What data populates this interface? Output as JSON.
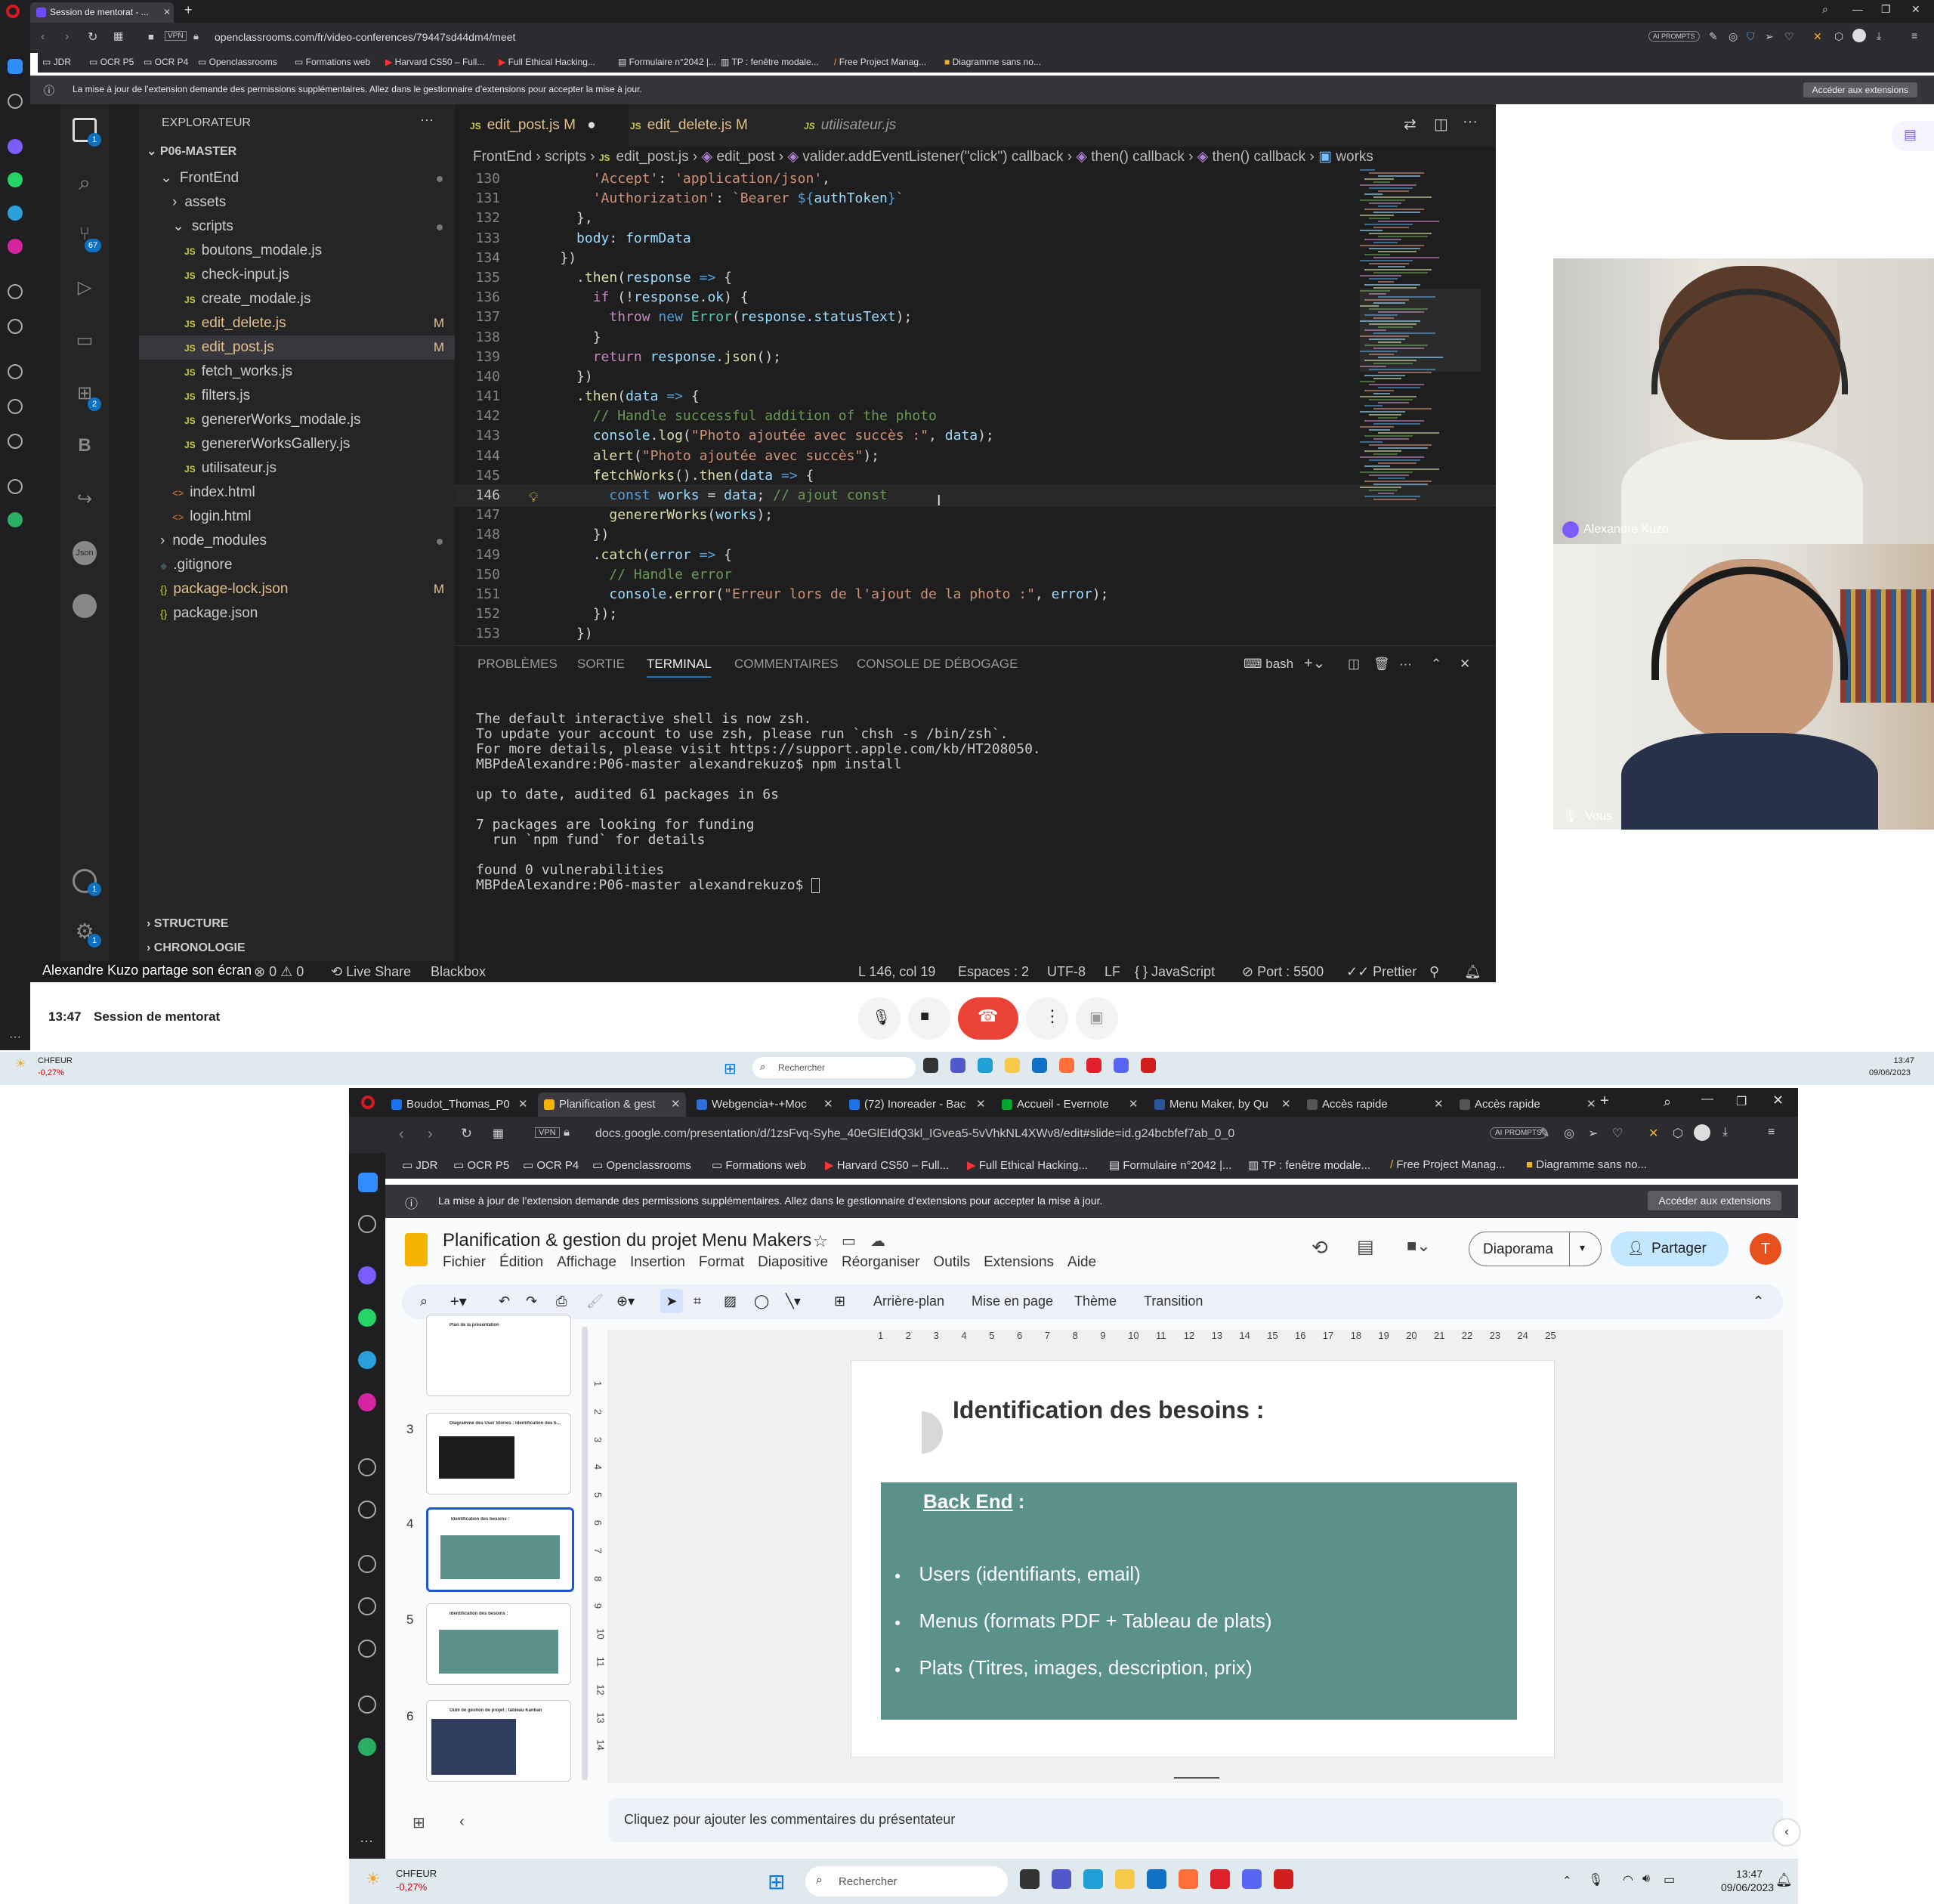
{
  "browser_top": {
    "tab_title": "Session de mentorat - ...",
    "url": "openclassrooms.com/fr/video-conferences/79447sd44dm4/meet",
    "vpn": "VPN",
    "ai_prompts": "AI PROMPTS",
    "bookmarks": [
      "JDR",
      "OCR P5",
      "OCR P4",
      "Openclassrooms",
      "Formations web",
      "Harvard CS50 – Full...",
      "Full Ethical Hacking...",
      "Formulaire n°2042 |...",
      "TP : fenêtre modale...",
      "Free Project Manag...",
      "Diagramme sans no..."
    ],
    "notice": "La mise à jour de l’extension demande des permissions supplémentaires. Allez dans le gestionnaire d’extensions pour accepter la mise à jour.",
    "notice_button": "Accéder aux extensions"
  },
  "vscode": {
    "explorer_title": "EXPLORATEUR",
    "root": "P06-MASTER",
    "tree": [
      {
        "name": "FrontEnd",
        "kind": "folder-open",
        "depth": 1,
        "dot": true
      },
      {
        "name": "assets",
        "kind": "folder",
        "depth": 2
      },
      {
        "name": "scripts",
        "kind": "folder-open",
        "depth": 2,
        "dot": true
      },
      {
        "name": "boutons_modale.js",
        "kind": "js",
        "depth": 3
      },
      {
        "name": "check-input.js",
        "kind": "js",
        "depth": 3
      },
      {
        "name": "create_modale.js",
        "kind": "js",
        "depth": 3
      },
      {
        "name": "edit_delete.js",
        "kind": "js",
        "depth": 3,
        "badge": "M"
      },
      {
        "name": "edit_post.js",
        "kind": "js",
        "depth": 3,
        "badge": "M",
        "selected": true
      },
      {
        "name": "fetch_works.js",
        "kind": "js",
        "depth": 3
      },
      {
        "name": "filters.js",
        "kind": "js",
        "depth": 3
      },
      {
        "name": "genererWorks_modale.js",
        "kind": "js",
        "depth": 3
      },
      {
        "name": "genererWorksGallery.js",
        "kind": "js",
        "depth": 3
      },
      {
        "name": "utilisateur.js",
        "kind": "js",
        "depth": 3
      },
      {
        "name": "index.html",
        "kind": "html",
        "depth": 2
      },
      {
        "name": "login.html",
        "kind": "html",
        "depth": 2
      },
      {
        "name": "node_modules",
        "kind": "folder",
        "depth": 1,
        "dot": true
      },
      {
        "name": ".gitignore",
        "kind": "git",
        "depth": 1
      },
      {
        "name": "package-lock.json",
        "kind": "json",
        "depth": 1,
        "badge": "M"
      },
      {
        "name": "package.json",
        "kind": "json",
        "depth": 1
      }
    ],
    "structure": "STRUCTURE",
    "chronologie": "CHRONOLOGIE",
    "tabs": [
      {
        "label": "edit_post.js",
        "mod": "M",
        "active": true
      },
      {
        "label": "edit_delete.js",
        "mod": "M"
      },
      {
        "label": "utilisateur.js",
        "italic": true
      }
    ],
    "breadcrumb": [
      "FrontEnd",
      "scripts",
      "edit_post.js",
      "edit_post",
      "valider.addEventListener(\"click\") callback",
      "then() callback",
      "then() callback",
      "works"
    ],
    "code_lines": [
      {
        "n": "130",
        "html": "        <span class=\"s\">'Accept'</span><span class=\"p\">: </span><span class=\"s\">'application/json'</span><span class=\"p\">,</span>"
      },
      {
        "n": "131",
        "html": "        <span class=\"s\">'Authorization'</span><span class=\"p\">: </span><span class=\"s\">`Bearer </span><span class=\"k\">${</span><span class=\"v\">authToken</span><span class=\"k\">}</span><span class=\"s\">`</span>"
      },
      {
        "n": "132",
        "html": "      <span class=\"p\">},</span>"
      },
      {
        "n": "133",
        "html": "      <span class=\"v\">body</span><span class=\"p\">: </span><span class=\"v\">formData</span>"
      },
      {
        "n": "134",
        "html": "    <span class=\"p\">})</span>"
      },
      {
        "n": "135",
        "html": "      <span class=\"p\">.</span><span class=\"f\">then</span><span class=\"p\">(</span><span class=\"v\">response</span> <span class=\"k\">=&gt;</span> <span class=\"p\">{</span>"
      },
      {
        "n": "136",
        "html": "        <span class=\"ctl\">if</span> <span class=\"p\">(!</span><span class=\"v\">response</span><span class=\"p\">.</span><span class=\"v\">ok</span><span class=\"p\">) {</span>"
      },
      {
        "n": "137",
        "html": "          <span class=\"ctl\">throw</span> <span class=\"k\">new</span> <span class=\"cls\">Error</span><span class=\"p\">(</span><span class=\"v\">response</span><span class=\"p\">.</span><span class=\"v\">statusText</span><span class=\"p\">);</span>"
      },
      {
        "n": "138",
        "html": "        <span class=\"p\">}</span>"
      },
      {
        "n": "139",
        "html": "        <span class=\"ctl\">return</span> <span class=\"v\">response</span><span class=\"p\">.</span><span class=\"f\">json</span><span class=\"p\">();</span>"
      },
      {
        "n": "140",
        "html": "      <span class=\"p\">})</span>"
      },
      {
        "n": "141",
        "html": "      <span class=\"p\">.</span><span class=\"f\">then</span><span class=\"p\">(</span><span class=\"v\">data</span> <span class=\"k\">=&gt;</span> <span class=\"p\">{</span>"
      },
      {
        "n": "142",
        "html": "        <span class=\"c\">// Handle successful addition of the photo</span>"
      },
      {
        "n": "143",
        "html": "        <span class=\"v\">console</span><span class=\"p\">.</span><span class=\"f\">log</span><span class=\"p\">(</span><span class=\"s\">\"Photo ajoutée avec succès :\"</span><span class=\"p\">, </span><span class=\"v\">data</span><span class=\"p\">);</span>"
      },
      {
        "n": "144",
        "html": "        <span class=\"f\">alert</span><span class=\"p\">(</span><span class=\"s\">\"Photo ajoutée avec succès\"</span><span class=\"p\">);</span>"
      },
      {
        "n": "145",
        "html": "        <span class=\"f\">fetchWorks</span><span class=\"p\">().</span><span class=\"f\">then</span><span class=\"p\">(</span><span class=\"v\">data</span> <span class=\"k\">=&gt;</span> <span class=\"p\">{</span>"
      },
      {
        "n": "146",
        "cur": true,
        "html": "          <span class=\"k\">const</span> <span class=\"v\">works</span> <span class=\"p\">= </span><span class=\"v\">data</span><span class=\"p\">; </span><span class=\"c\">// ajout const</span>"
      },
      {
        "n": "147",
        "html": "          <span class=\"f\">genererWorks</span><span class=\"p\">(</span><span class=\"v\">works</span><span class=\"p\">);</span>"
      },
      {
        "n": "148",
        "html": "        <span class=\"p\">})</span>"
      },
      {
        "n": "149",
        "html": "        <span class=\"p\">.</span><span class=\"f\">catch</span><span class=\"p\">(</span><span class=\"v\">error</span> <span class=\"k\">=&gt;</span> <span class=\"p\">{</span>"
      },
      {
        "n": "150",
        "html": "          <span class=\"c\">// Handle error</span>"
      },
      {
        "n": "151",
        "html": "          <span class=\"v\">console</span><span class=\"p\">.</span><span class=\"f\">error</span><span class=\"p\">(</span><span class=\"s\">\"Erreur lors de l'ajout de la photo :\"</span><span class=\"p\">, </span><span class=\"v\">error</span><span class=\"p\">);</span>"
      },
      {
        "n": "152",
        "html": "        <span class=\"p\">});</span>"
      },
      {
        "n": "153",
        "html": "      <span class=\"p\">})</span>"
      }
    ],
    "panel_tabs": [
      "PROBLÈMES",
      "SORTIE",
      "TERMINAL",
      "COMMENTAIRES",
      "CONSOLE DE DÉBOGAGE"
    ],
    "shell": "bash",
    "terminal": [
      "The default interactive shell is now zsh.",
      "To update your account to use zsh, please run `chsh -s /bin/zsh`.",
      "For more details, please visit https://support.apple.com/kb/HT208050.",
      "MBPdeAlexandre:P06-master alexandrekuzo$ npm install",
      "",
      "up to date, audited 61 packages in 6s",
      "",
      "7 packages are looking for funding",
      "  run `npm fund` for details",
      "",
      "found 0 vulnerabilities",
      "MBPdeAlexandre:P06-master alexandrekuzo$ "
    ],
    "status_left": [
      "Alexandre Kuzo partage son écran",
      "⊗ 0 ⚠ 0",
      "Live Share",
      "Blackbox"
    ],
    "status_right": [
      "L 146, col 19",
      "Espaces : 2",
      "UTF-8",
      "LF",
      "JavaScript",
      "Port : 5500",
      "Prettier"
    ],
    "badges": {
      "source_control": "67",
      "extensions": "2",
      "account": "1",
      "settings": "1",
      "explorer": "1"
    }
  },
  "meet": {
    "participant1": "Alexandre Kuzo",
    "participant2": "Vous",
    "time": "13:47",
    "title": "Session de mentorat"
  },
  "taskbar_mid": {
    "weather_label": "CHFEUR",
    "weather_change": "-0,27%",
    "search": "Rechercher",
    "time": "13:47",
    "date": "09/06/2023"
  },
  "browser2": {
    "tabs": [
      "Boudot_Thomas_P0",
      "Planification & gest",
      "Webgencia+-+Moc",
      "(72) Inoreader - Bac",
      "Accueil - Evernote",
      "Menu Maker, by Qu",
      "Accès rapide",
      "Accès rapide"
    ],
    "url": "docs.google.com/presentation/d/1zsFvq-Syhe_40eGlEIdQ3kl_IGvea5-5vVhkNL4XWv8/edit#slide=id.g24bcbfef7ab_0_0",
    "vpn": "VPN",
    "ai_prompts": "AI PROMPTS",
    "bookmarks": [
      "JDR",
      "OCR P5",
      "OCR P4",
      "Openclassrooms",
      "Formations web",
      "Harvard CS50 – Full...",
      "Full Ethical Hacking...",
      "Formulaire n°2042 |...",
      "TP : fenêtre modale...",
      "Free Project Manag...",
      "Diagramme sans no..."
    ],
    "notice": "La mise à jour de l’extension demande des permissions supplémentaires. Allez dans le gestionnaire d’extensions pour accepter la mise à jour.",
    "notice_button": "Accéder aux extensions"
  },
  "slides": {
    "doc_title": "Planification & gestion du projet Menu Makers",
    "menu": [
      "Fichier",
      "Édition",
      "Affichage",
      "Insertion",
      "Format",
      "Diapositive",
      "Réorganiser",
      "Outils",
      "Extensions",
      "Aide"
    ],
    "slideshow": "Diaporama",
    "share": "Partager",
    "avatar": "T",
    "tools_text": [
      "Arrière-plan",
      "Mise en page",
      "Thème",
      "Transition"
    ],
    "ruler": [
      "1",
      "2",
      "3",
      "4",
      "5",
      "6",
      "7",
      "8",
      "9",
      "10",
      "11",
      "12",
      "13",
      "14",
      "15",
      "16",
      "17",
      "18",
      "19",
      "20",
      "21",
      "22",
      "23",
      "24",
      "25"
    ],
    "thumbs": [
      {
        "num": "",
        "title": "Plan de la présentation"
      },
      {
        "num": "3",
        "title": "Diagramme des User Stories : Identification des besoins"
      },
      {
        "num": "4",
        "title": "Identification des besoins :",
        "selected": true
      },
      {
        "num": "5",
        "title": "Identification des besoins :"
      },
      {
        "num": "6",
        "title": "Outil de gestion de projet : tableau Kanban"
      }
    ],
    "slide_title": "Identification des besoins :",
    "box_heading": "Back End",
    "box_colon": " :",
    "bullets": [
      "Users (identifiants, email)",
      "Menus (formats PDF + Tableau de plats)",
      "Plats (Titres, images, description, prix)"
    ],
    "notes": "Cliquez pour ajouter les commentaires du présentateur",
    "box_color": "#5a918b"
  },
  "taskbar2": {
    "weather_label": "CHFEUR",
    "weather_change": "-0,27%",
    "search": "Rechercher",
    "time": "13:47",
    "date": "09/06/2023"
  }
}
